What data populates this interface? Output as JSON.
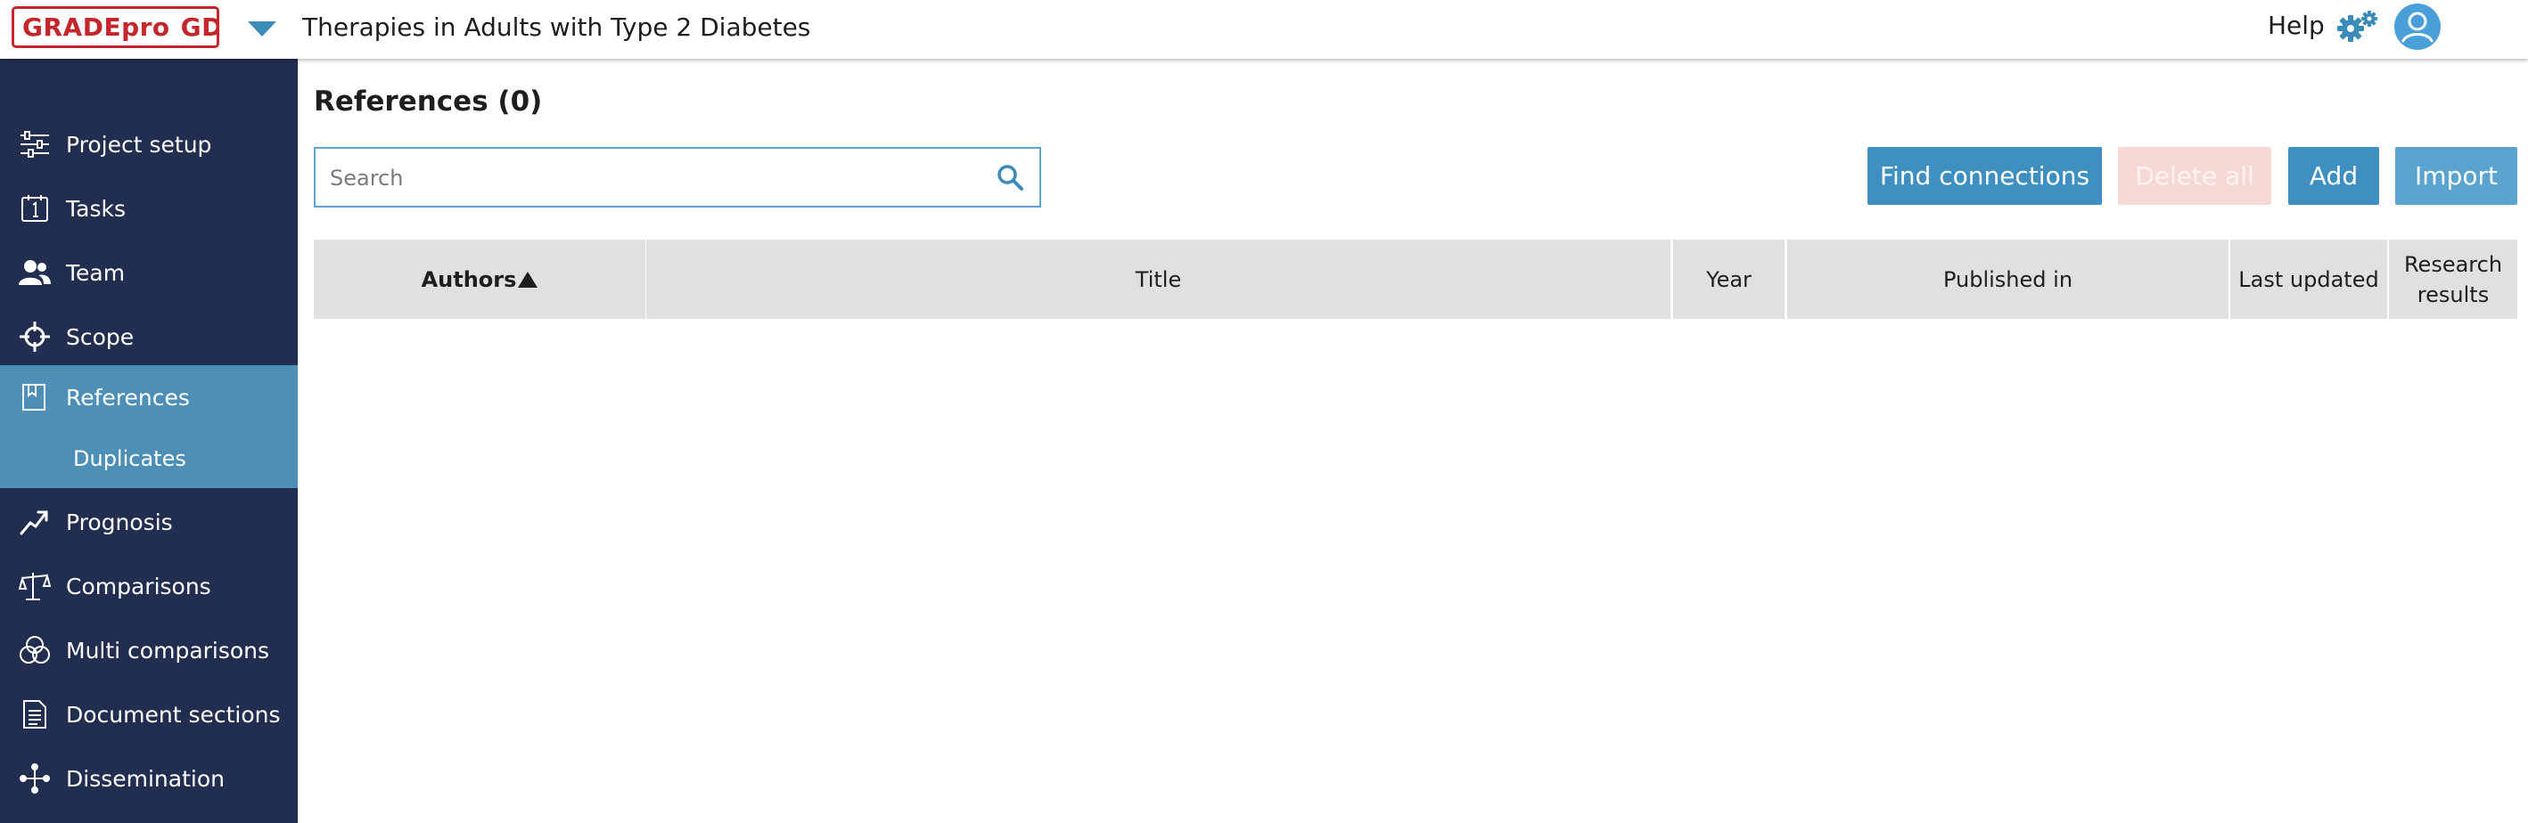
{
  "header": {
    "logo_left": "GRADEpro",
    "logo_right": "GDT",
    "project_title": "Therapies in Adults with Type 2 Diabetes",
    "help_label": "Help",
    "icons": [
      "chevron-down-icon",
      "settings-gears-icon",
      "user-avatar-icon"
    ]
  },
  "sidebar": {
    "items": [
      {
        "label": "Project setup",
        "icon": "sliders-icon",
        "active": false
      },
      {
        "label": "Tasks",
        "icon": "calendar-icon",
        "active": false
      },
      {
        "label": "Team",
        "icon": "users-icon",
        "active": false
      },
      {
        "label": "Scope",
        "icon": "crosshair-icon",
        "active": false
      },
      {
        "label": "References",
        "icon": "document-chart-icon",
        "active": true
      },
      {
        "label": "Prognosis",
        "icon": "trend-arrow-icon",
        "active": false
      },
      {
        "label": "Comparisons",
        "icon": "scale-icon",
        "active": false
      },
      {
        "label": "Multi comparisons",
        "icon": "venn-icon",
        "active": false
      },
      {
        "label": "Document sections",
        "icon": "document-icon",
        "active": false
      },
      {
        "label": "Dissemination",
        "icon": "share-network-icon",
        "active": false
      }
    ],
    "sub_items": [
      {
        "label": "Duplicates",
        "parent": "References"
      }
    ]
  },
  "main": {
    "title": "References (0)",
    "search": {
      "placeholder": "Search",
      "value": ""
    },
    "buttons": {
      "find_connections": "Find connections",
      "delete_all": "Delete all",
      "add": "Add",
      "import": "Import"
    },
    "table": {
      "columns": [
        "Authors",
        "Title",
        "Year",
        "Published in",
        "Last updated",
        "Research results"
      ],
      "sorted_by": "Authors",
      "sort_direction": "ascending",
      "rows": []
    }
  },
  "colors": {
    "sidebar_bg": "#222e4f",
    "sidebar_active": "#4d8fb7",
    "primary_button": "#3f90c0",
    "disabled_danger_button": "#f7d8d4",
    "logo_red": "#c3272b",
    "table_header_bg": "#e0e0e0"
  }
}
